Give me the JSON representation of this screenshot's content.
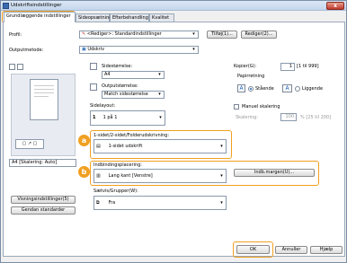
{
  "window": {
    "title": "Udskriftsindstillinger",
    "close_label": "x"
  },
  "tabs": [
    {
      "label": "Grundlæggende indstillinger"
    },
    {
      "label": "Sideopsætning"
    },
    {
      "label": "Efterbehandling"
    },
    {
      "label": "Kvalitet"
    }
  ],
  "profile": {
    "label": "Profil:",
    "value": "<Rediger>: Standardindstillinger",
    "add_button": "Tilføj(1)...",
    "edit_button": "Rediger(2)..."
  },
  "output": {
    "label": "Outputmetode:",
    "value": "Udskriv"
  },
  "page_size": {
    "label": "Sidestørrelse:",
    "value": "A4"
  },
  "output_size": {
    "label": "Outputstørrelse:",
    "value": "Match sidestørrelse"
  },
  "page_layout": {
    "label": "Sidelayout:",
    "value": "1 på 1"
  },
  "copies": {
    "label": "Kopier(G):",
    "value": "1",
    "range": "[1 til 999]"
  },
  "orientation": {
    "label": "Papirretning",
    "options": [
      "Stående",
      "Liggende"
    ],
    "selected": "Stående",
    "letter": "A"
  },
  "scaling": {
    "manual_label": "Manuel skalering",
    "label": "Skalering:",
    "value": "100",
    "range": "% [25 til 200]"
  },
  "duplex": {
    "label": "1-sidet/2-sidet/Folderudskrivning:",
    "value": "1-sidet udskrift"
  },
  "binding": {
    "label": "Indbindingsplacering:",
    "value": "Lang kant [Venstre]",
    "margin_button": "Indb.margen(U)..."
  },
  "collate": {
    "label": "Sætvis/Grupper(W):",
    "value": "Fra"
  },
  "preview": {
    "caption": "A4 [Skalering: Auto]"
  },
  "left_buttons": {
    "view_settings": "Visningsindstillinger(5)",
    "restore": "Gendan standarder"
  },
  "footer": {
    "ok": "OK",
    "cancel": "Annuller",
    "help": "Hjælp"
  },
  "callouts": {
    "a": "a",
    "b": "b"
  },
  "colors": {
    "accent": "#f0a020",
    "titlebar": "#c4d6ec"
  }
}
